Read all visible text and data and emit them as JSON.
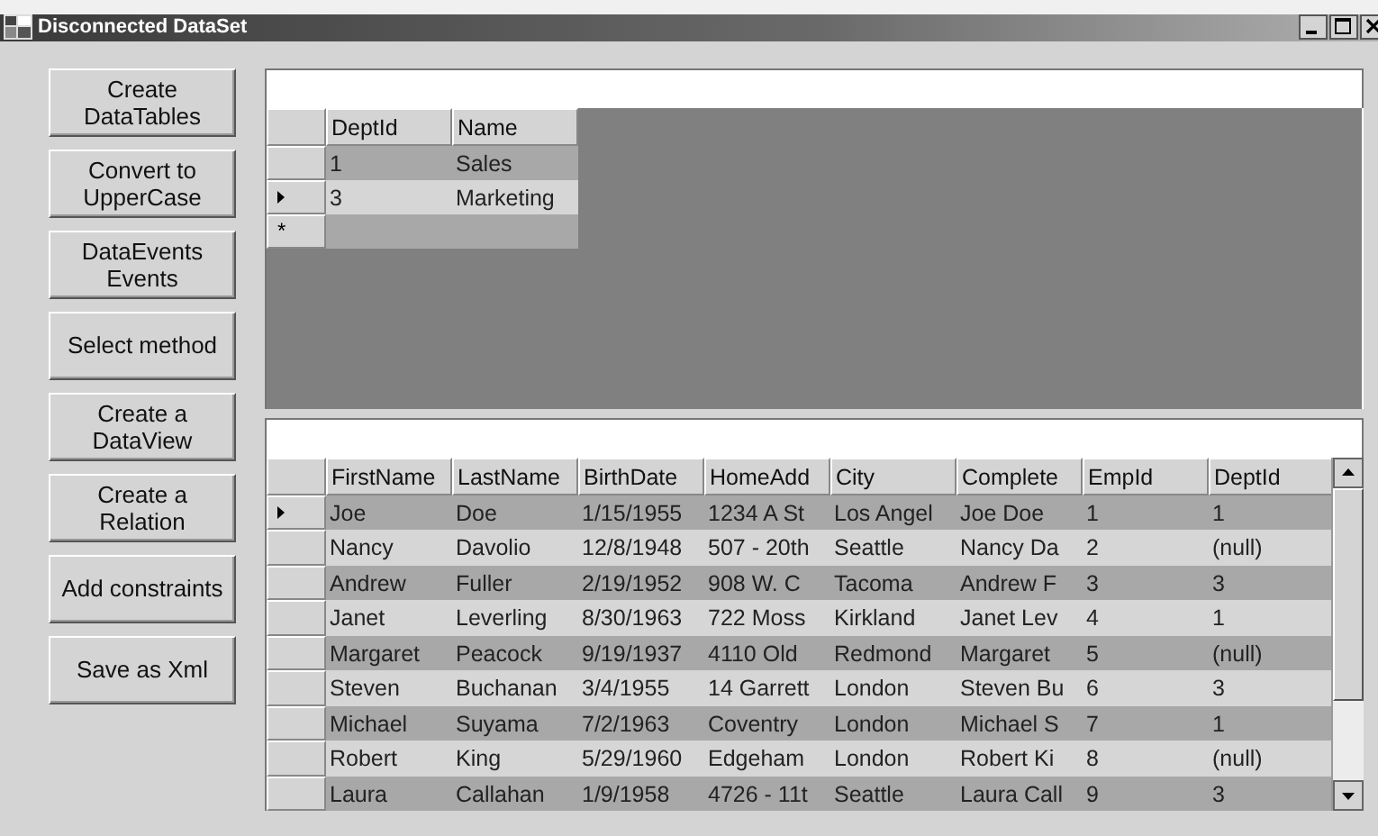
{
  "window": {
    "title": "Disconnected DataSet"
  },
  "buttons": [
    {
      "label": "Create DataTables"
    },
    {
      "label": "Convert to UpperCase"
    },
    {
      "label": "DataEvents Events"
    },
    {
      "label": "Select method"
    },
    {
      "label": "Create a DataView"
    },
    {
      "label": "Create a Relation"
    },
    {
      "label": "Add constraints"
    },
    {
      "label": "Save as Xml"
    }
  ],
  "departments_grid": {
    "columns": [
      "DeptId",
      "Name"
    ],
    "rows": [
      {
        "cells": [
          "1",
          "Sales"
        ],
        "current": false
      },
      {
        "cells": [
          "3",
          "Marketing"
        ],
        "current": true
      }
    ],
    "new_row_marker": "*"
  },
  "employees_grid": {
    "columns": [
      "FirstName",
      "LastName",
      "BirthDate",
      "HomeAdd",
      "City",
      "Complete",
      "EmpId",
      "DeptId"
    ],
    "rows": [
      {
        "cells": [
          "Joe",
          "Doe",
          "1/15/1955",
          "1234 A St",
          "Los Angel",
          "Joe Doe",
          "1",
          "1"
        ],
        "current": true
      },
      {
        "cells": [
          "Nancy",
          "Davolio",
          "12/8/1948",
          "507 - 20th",
          "Seattle",
          "Nancy Da",
          "2",
          "(null)"
        ],
        "current": false
      },
      {
        "cells": [
          "Andrew",
          "Fuller",
          "2/19/1952",
          "908 W. C",
          "Tacoma",
          "Andrew F",
          "3",
          "3"
        ],
        "current": false
      },
      {
        "cells": [
          "Janet",
          "Leverling",
          "8/30/1963",
          "722 Moss",
          "Kirkland",
          "Janet Lev",
          "4",
          "1"
        ],
        "current": false
      },
      {
        "cells": [
          "Margaret",
          "Peacock",
          "9/19/1937",
          "4110 Old",
          "Redmond",
          "Margaret",
          "5",
          "(null)"
        ],
        "current": false
      },
      {
        "cells": [
          "Steven",
          "Buchanan",
          "3/4/1955",
          "14 Garrett",
          "London",
          "Steven Bu",
          "6",
          "3"
        ],
        "current": false
      },
      {
        "cells": [
          "Michael",
          "Suyama",
          "7/2/1963",
          "Coventry",
          "London",
          "Michael S",
          "7",
          "1"
        ],
        "current": false
      },
      {
        "cells": [
          "Robert",
          "King",
          "5/29/1960",
          "Edgeham",
          "London",
          "Robert Ki",
          "8",
          "(null)"
        ],
        "current": false
      },
      {
        "cells": [
          "Laura",
          "Callahan",
          "1/9/1958",
          "4726 - 11t",
          "Seattle",
          "Laura Call",
          "9",
          "3"
        ],
        "current": false
      }
    ]
  }
}
